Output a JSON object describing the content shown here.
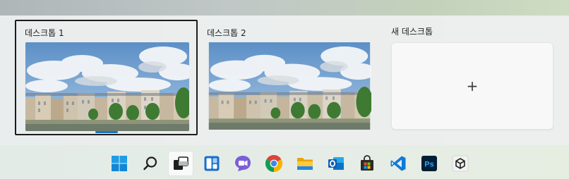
{
  "desktops": [
    {
      "label": "데스크톱 1",
      "selected": true
    },
    {
      "label": "데스크톱 2",
      "selected": false
    }
  ],
  "new_desktop": {
    "label": "새 데스크톱",
    "plus": "+"
  },
  "taskbar": {
    "items": [
      {
        "icon": "windows-start-icon",
        "active": false
      },
      {
        "icon": "search-icon",
        "active": false
      },
      {
        "icon": "task-view-icon",
        "active": true
      },
      {
        "icon": "widgets-icon",
        "active": false
      },
      {
        "icon": "teams-chat-icon",
        "active": false
      },
      {
        "icon": "chrome-icon",
        "active": false
      },
      {
        "icon": "file-explorer-icon",
        "active": false
      },
      {
        "icon": "outlook-icon",
        "active": false
      },
      {
        "icon": "microsoft-store-icon",
        "active": false
      },
      {
        "icon": "vscode-icon",
        "active": false
      },
      {
        "icon": "photoshop-icon",
        "active": false,
        "text": "Ps"
      },
      {
        "icon": "unity-icon",
        "active": false
      }
    ]
  },
  "colors": {
    "accent": "#1a73c8",
    "selection_border": "#1c1c1c"
  }
}
